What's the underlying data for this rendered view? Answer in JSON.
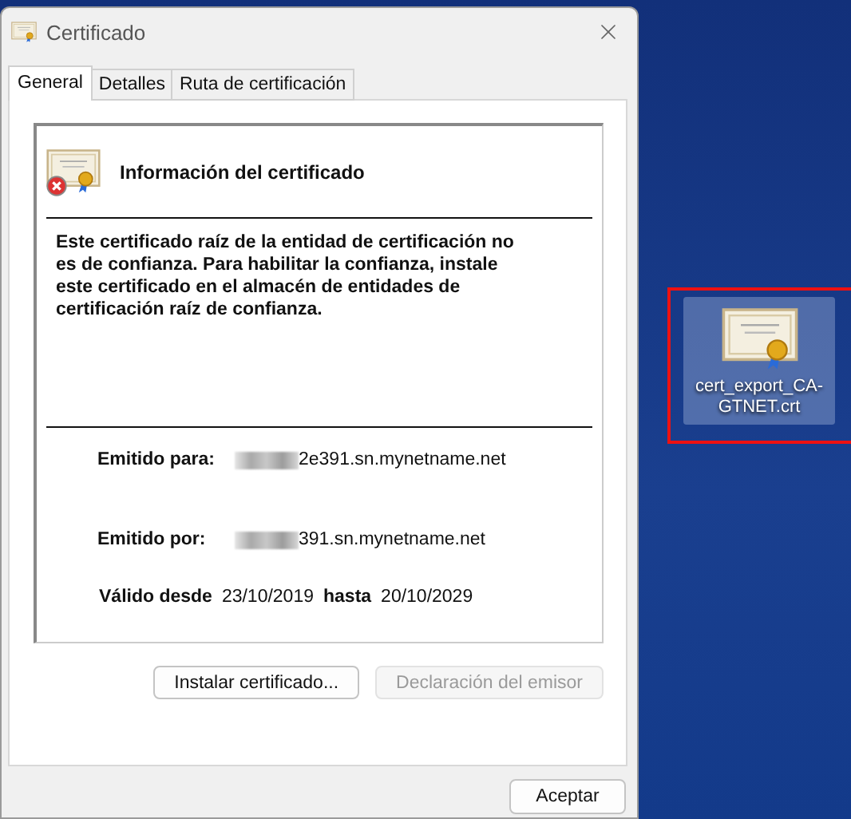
{
  "window": {
    "title": "Certificado"
  },
  "tabs": [
    {
      "label": "General",
      "selected": true
    },
    {
      "label": "Detalles",
      "selected": false
    },
    {
      "label": "Ruta de certificación",
      "selected": false
    }
  ],
  "info": {
    "heading": "Información del certificado",
    "trusted": false,
    "message": "Este certificado raíz de la entidad de certificación no es de confianza. Para habilitar la confianza, instale este certificado en el almacén de entidades de certificación raíz de confianza."
  },
  "fields": [
    {
      "label": "Emitido para:",
      "value": "2e391.sn.mynetname.net",
      "redacted": true
    },
    {
      "label": "Emitido por:",
      "value": "391.sn.mynetname.net",
      "redacted": true
    }
  ],
  "validity": {
    "from_label": "Válido desde",
    "from": "23/10/2019",
    "to_label": "hasta",
    "to": "20/10/2029"
  },
  "buttons": [
    {
      "label": "Instalar certificado...",
      "disabled": false
    },
    {
      "label": "Declaración del emisor",
      "disabled": true
    }
  ],
  "ok_button": {
    "label": "Aceptar"
  },
  "desktop_icon": {
    "label": "cert_export_CA-GTNET.crt",
    "selected": true,
    "highlighted": true
  }
}
